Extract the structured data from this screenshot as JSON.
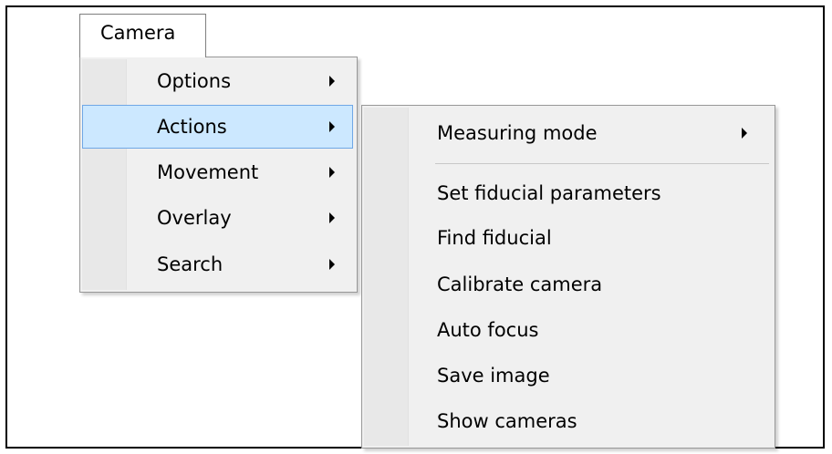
{
  "menu_bar": {
    "title": "Camera"
  },
  "camera_menu": {
    "items": [
      {
        "label": "Options"
      },
      {
        "label": "Actions"
      },
      {
        "label": "Movement"
      },
      {
        "label": "Overlay"
      },
      {
        "label": "Search"
      }
    ]
  },
  "actions_submenu": {
    "items": [
      {
        "label": "Measuring mode"
      },
      {
        "label": "Set fiducial parameters"
      },
      {
        "label": "Find fiducial"
      },
      {
        "label": "Calibrate camera"
      },
      {
        "label": "Auto focus"
      },
      {
        "label": "Save image"
      },
      {
        "label": "Show cameras"
      }
    ]
  },
  "colors": {
    "highlight": "#cce8ff",
    "highlight_border": "#6fa7e6",
    "menu_bg": "#f0f0f0"
  }
}
